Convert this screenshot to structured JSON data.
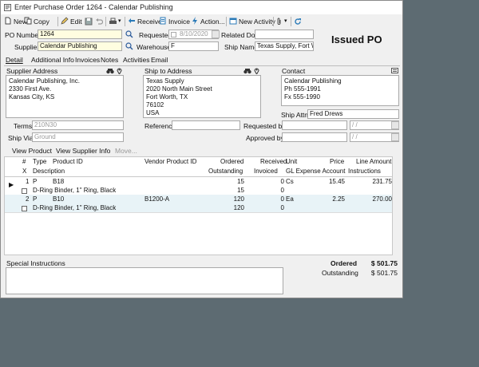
{
  "window": {
    "title": "Enter Purchase Order 1264 - Calendar Publishing"
  },
  "toolbar": {
    "new": "New",
    "copy": "Copy",
    "edit": "Edit",
    "receive": "Receive",
    "invoice": "Invoice",
    "action": "Action...",
    "new_activity": "New Activity"
  },
  "header": {
    "po_number_label": "PO Number",
    "po_number": "1264",
    "supplier_label": "Supplier",
    "supplier": "Calendar Publishing",
    "requested_label": "Requested",
    "requested_date": "8/10/2020",
    "warehouse_label": "Warehouse",
    "warehouse": "F",
    "related_doc_label": "Related Doc",
    "related_doc": "",
    "ship_name_label": "Ship Name",
    "ship_name": "Texas Supply, Fort Wc",
    "status": "Issued PO"
  },
  "tabs": [
    "Detail",
    "Additional Info",
    "Invoices",
    "Notes",
    "Activities",
    "Email"
  ],
  "detail": {
    "supplier_address_label": "Supplier Address",
    "supplier_address": "Calendar Publishing, Inc.\n2330 First Ave.\nKansas City, KS",
    "ship_to_label": "Ship to Address",
    "ship_to": "Texas Supply\n2020 North Main Street\nFort Worth, TX\n76102\nUSA",
    "contact_label": "Contact",
    "contact": "Calendar Publishing\nPh 555-1991\nFx 555-1990",
    "ship_attn_label": "Ship Attn",
    "ship_attn": "Fred Drews",
    "terms_label": "Terms",
    "terms": "210N30",
    "ship_via_label": "Ship Via",
    "ship_via": "Ground",
    "reference_label": "Reference",
    "reference": "",
    "requested_by_label": "Requested by",
    "requested_by": "",
    "approved_by_label": "Approved by",
    "approved_by": "",
    "date_placeholder": "/ /"
  },
  "view_tabs": {
    "product": "View Product",
    "supplier_info": "View Supplier Info",
    "move": "Move..."
  },
  "grid": {
    "header1": [
      "#",
      "Type",
      "Product ID",
      "Vendor Product ID",
      "Ordered",
      "Received",
      "Unit",
      "Price",
      "Line Amount"
    ],
    "header2": [
      "X",
      "Description",
      "Outstanding",
      "Invoiced",
      "GL Expense Account",
      "Instructions"
    ],
    "rows": [
      {
        "num": "1",
        "type": "P",
        "product_id": "B18",
        "vendor_id": "",
        "ordered": "15",
        "received": "0",
        "unit": "Cs",
        "price": "15.45",
        "amount": "231.75",
        "description": "D-Ring Binder, 1\" Ring, Black",
        "outstanding": "15",
        "invoiced": "0"
      },
      {
        "num": "2",
        "type": "P",
        "product_id": "B10",
        "vendor_id": "B1200-A",
        "ordered": "120",
        "received": "0",
        "unit": "Ea",
        "price": "2.25",
        "amount": "270.00",
        "description": "D-Ring Binder, 1\" Ring, Black",
        "outstanding": "120",
        "invoiced": "0"
      }
    ]
  },
  "footer": {
    "special_instructions_label": "Special Instructions",
    "ordered_label": "Ordered",
    "ordered_total": "$ 501.75",
    "outstanding_label": "Outstanding",
    "outstanding_total": "$ 501.75"
  }
}
